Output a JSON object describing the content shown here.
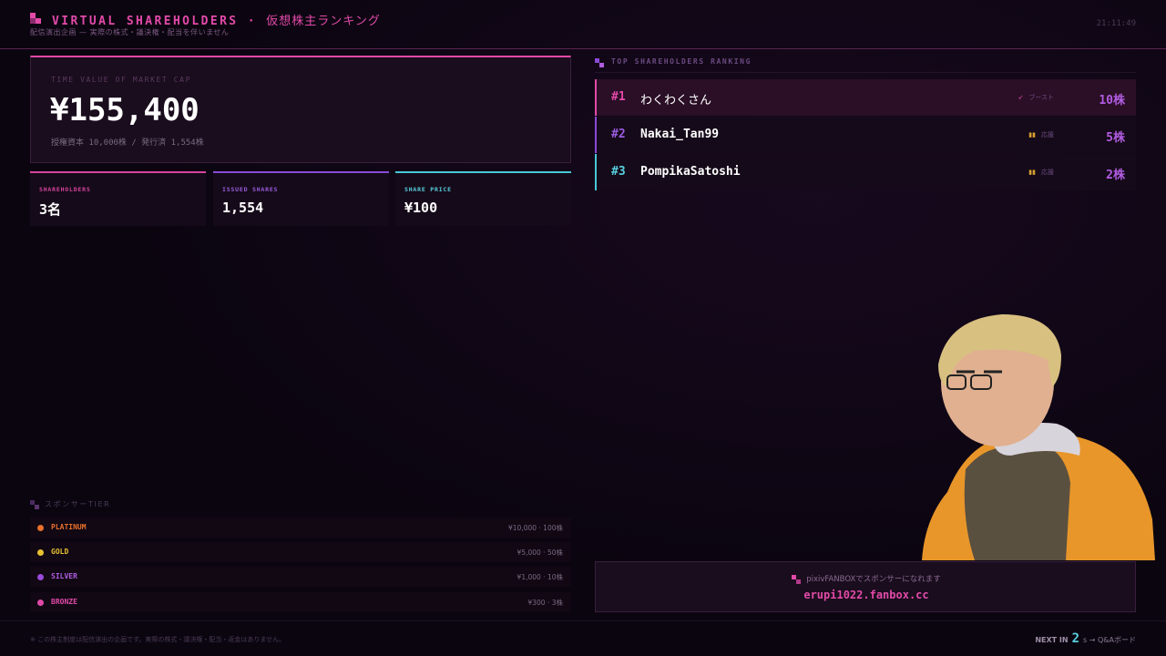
{
  "header": {
    "title": "VIRTUAL SHAREHOLDERS",
    "title_sep": " · ",
    "title_jp": "仮想株主ランキング",
    "subtitle": "配信演出企画 — 実際の株式・議決権・配当を伴いません",
    "clock": "21:11:49"
  },
  "market_cap": {
    "label": "TIME VALUE OF MARKET CAP",
    "value": "¥155,400",
    "sub": "授権資本 10,000株 / 発行済 1,554株"
  },
  "stats": [
    {
      "label": "SHAREHOLDERS",
      "value": "3名"
    },
    {
      "label": "ISSUED SHARES",
      "value": "1,554"
    },
    {
      "label": "SHARE PRICE",
      "value": "¥100"
    }
  ],
  "ranking": {
    "title": "TOP SHAREHOLDERS RANKING",
    "rows": [
      {
        "rank": "#1",
        "name": "わくわくさん",
        "tag": "ブースト",
        "tag_icon": "🚀",
        "shares": "10株"
      },
      {
        "rank": "#2",
        "name": "Nakai_Tan99",
        "tag": "応援",
        "tag_icon": "▮▮",
        "shares": "5株"
      },
      {
        "rank": "#3",
        "name": "PompikaSatoshi",
        "tag": "応援",
        "tag_icon": "▮▮",
        "shares": "2株"
      }
    ]
  },
  "tiers": {
    "title": "スポンサーTIER",
    "items": [
      {
        "name": "PLATINUM",
        "price": "¥10,000 · 100株",
        "color": "#e8702a"
      },
      {
        "name": "GOLD",
        "price": "¥5,000 · 50株",
        "color": "#e8c030"
      },
      {
        "name": "SILVER",
        "price": "¥1,000 · 10株",
        "color": "#9a4ad8"
      },
      {
        "name": "BRONZE",
        "price": "¥300 · 3株",
        "color": "#e24aa8"
      }
    ]
  },
  "fanbox": {
    "label": "pixivFANBOXでスポンサーになれます",
    "url": "erupi1022.fanbox.cc"
  },
  "footer": {
    "disclaimer": "※ この株主制度は配信演出の企画です。実際の株式・議決権・配当・返金はありません。",
    "next_label": "NEXT IN",
    "next_value": "2",
    "next_suffix": "s → Q&Aボード"
  }
}
